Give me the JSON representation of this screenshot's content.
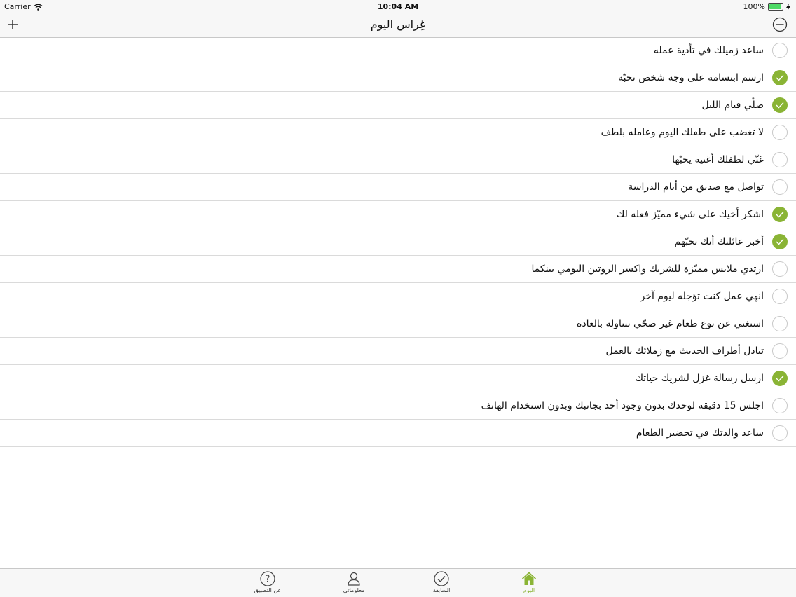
{
  "status": {
    "carrier": "Carrier",
    "time": "10:04 AM",
    "battery": "100%"
  },
  "header": {
    "title": "غِراس اليوم"
  },
  "items": [
    {
      "label": "ساعد زميلك في تأدية عمله",
      "done": false
    },
    {
      "label": "ارسم ابتسامة على وجه شخص تحبّه",
      "done": true
    },
    {
      "label": "صلّي قيام الليل",
      "done": true
    },
    {
      "label": "لا تغضب على طفلك اليوم وعامله بلطف",
      "done": false
    },
    {
      "label": "غنّي لطفلك أغنية يحبّها",
      "done": false
    },
    {
      "label": "تواصل مع صديق من أيام الدراسة",
      "done": false
    },
    {
      "label": "اشكر أخيك على شيء مميّز فعله لك",
      "done": true
    },
    {
      "label": "أخبر عائلتك أنك تحبّهم",
      "done": true
    },
    {
      "label": "ارتدي ملابس مميّزة للشريك واكسر الروتين اليومي بينكما",
      "done": false
    },
    {
      "label": "انهي عمل كنت تؤجله ليوم آخر",
      "done": false
    },
    {
      "label": "استغني عن نوع طعام غير صحّي تتناوله بالعادة",
      "done": false
    },
    {
      "label": "تبادل أطراف الحديث مع زملائك بالعمل",
      "done": false
    },
    {
      "label": "ارسل رسالة غزل لشريك حياتك",
      "done": true
    },
    {
      "label": "اجلس 15 دقيقة لوحدك بدون وجود أحد بجانبك وبدون استخدام الهاتف",
      "done": false
    },
    {
      "label": "ساعد والدتك في تحضير الطعام",
      "done": false
    }
  ],
  "tabs": {
    "about": "عن التطبيق",
    "info": "معلوماتي",
    "previous": "السابقة",
    "today": "اليوم"
  },
  "colors": {
    "accent": "#8ab435"
  }
}
